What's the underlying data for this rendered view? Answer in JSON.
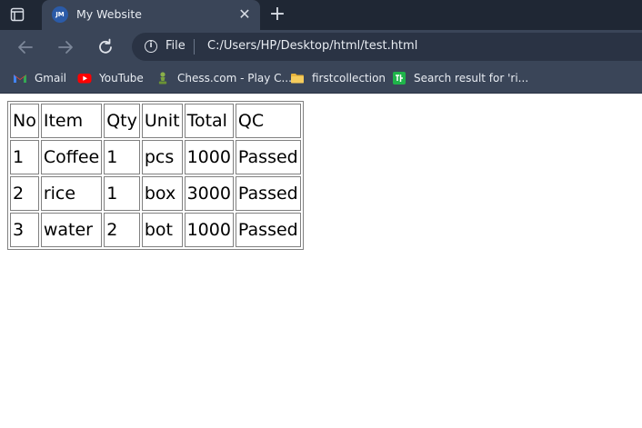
{
  "browser": {
    "tab": {
      "title": "My Website",
      "favicon_text": "JM"
    },
    "address": {
      "scheme_label": "File",
      "url": "C:/Users/HP/Desktop/html/test.html"
    },
    "bookmarks": [
      {
        "label": "Gmail",
        "icon": "gmail-icon"
      },
      {
        "label": "YouTube",
        "icon": "youtube-icon"
      },
      {
        "label": "Chess.com - Play C...",
        "icon": "chess-pawn-icon"
      },
      {
        "label": "firstcollection",
        "icon": "folder-icon"
      },
      {
        "label": "Search result for 'ri...",
        "icon": "search-site-icon"
      }
    ],
    "colors": {
      "frame": "#1f2734",
      "toolbar": "#3a4558",
      "omnibox": "#2a3344"
    }
  },
  "table": {
    "header": [
      "No",
      "Item",
      "Qty",
      "Unit",
      "Total",
      "QC"
    ],
    "rows": [
      [
        "1",
        "Coffee",
        "1",
        "pcs",
        "1000",
        "Passed"
      ],
      [
        "2",
        "rice",
        "1",
        "box",
        "3000",
        "Passed"
      ],
      [
        "3",
        "water",
        "2",
        "bot",
        "1000",
        "Passed"
      ]
    ]
  }
}
